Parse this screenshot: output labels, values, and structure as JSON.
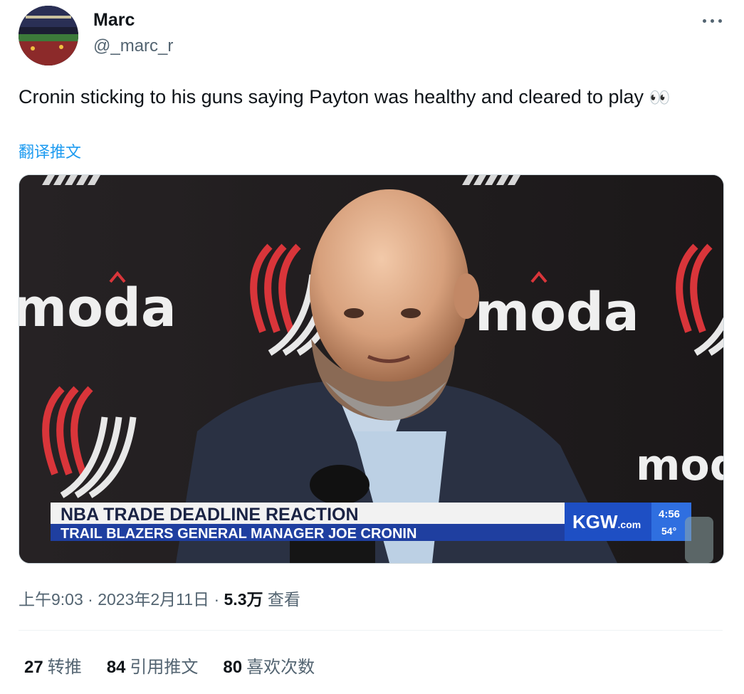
{
  "author": {
    "display_name": "Marc",
    "handle": "@_marc_r"
  },
  "tweet": {
    "text": "Cronin sticking to his guns saying Payton was healthy and cleared to play",
    "emoji": "👀",
    "translate_label": "翻译推文"
  },
  "media": {
    "backdrop_logo_text": "moda",
    "chyron": {
      "headline": "NBA TRADE DEADLINE REACTION",
      "subline": "TRAIL BLAZERS GENERAL MANAGER JOE CRONIN",
      "station": "KGW",
      "station_suffix": ".com",
      "time": "4:56",
      "temperature": "54°"
    }
  },
  "meta": {
    "time": "上午9:03",
    "separator": "·",
    "date": "2023年2月11日",
    "views_count": "5.3万",
    "views_label": "查看"
  },
  "stats": {
    "retweets": {
      "count": "27",
      "label": "转推"
    },
    "quotes": {
      "count": "84",
      "label": "引用推文"
    },
    "likes": {
      "count": "80",
      "label": "喜欢次数"
    }
  },
  "icons": {
    "more": "more-horizontal-icon",
    "eyes": "eyes-emoji"
  },
  "colors": {
    "link": "#1d9bf0",
    "secondary_text": "#536471",
    "blazers_red": "#e03a3e",
    "chyron_blue": "#1f3fa0"
  }
}
